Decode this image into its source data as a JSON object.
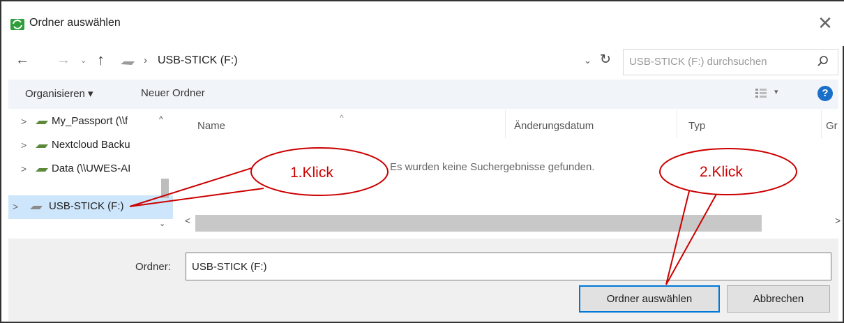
{
  "window": {
    "title": "Ordner auswählen",
    "close_glyph": "✕"
  },
  "address": {
    "back_glyph": "←",
    "forward_glyph": "→",
    "recent_glyph": "⌄",
    "up_glyph": "↑",
    "separator": "›",
    "path": "USB-STICK (F:)",
    "dropdown_glyph": "⌄",
    "refresh_glyph": "↻"
  },
  "search": {
    "placeholder": "USB-STICK (F:) durchsuchen"
  },
  "toolbar": {
    "organize_label": "Organisieren ▾",
    "new_folder_label": "Neuer Ordner",
    "view_drop_glyph": "▾",
    "help_glyph": "?"
  },
  "sidebar": {
    "items": [
      {
        "label": "My_Passport (\\\\f"
      },
      {
        "label": "Nextcloud Backu"
      },
      {
        "label": "Data (\\\\UWES-AI"
      },
      {
        "label": "USB-STICK (F:)"
      }
    ],
    "chevron_glyph": ">",
    "scroll_up_glyph": "^",
    "scroll_down_glyph": "⌄"
  },
  "list": {
    "sort_glyph": "^",
    "columns": [
      "Name",
      "Änderungsdatum",
      "Typ",
      "Gr"
    ],
    "empty_message": "Es wurden keine Suchergebnisse gefunden.",
    "scroll_left_glyph": "<",
    "scroll_right_glyph": ">"
  },
  "footer": {
    "folder_label": "Ordner:",
    "folder_value": "USB-STICK (F:)",
    "select_button": "Ordner auswählen",
    "cancel_button": "Abbrechen"
  },
  "annotations": {
    "callout1": "1.Klick",
    "callout2": "2.Klick",
    "color": "#cc0000"
  },
  "colors": {
    "toolbar_bg": "#f1f4f9",
    "selection_bg": "#cde6fb",
    "accent": "#0078d7",
    "help_icon": "#1a6fc8",
    "app_icon": "#2e9e3a"
  }
}
